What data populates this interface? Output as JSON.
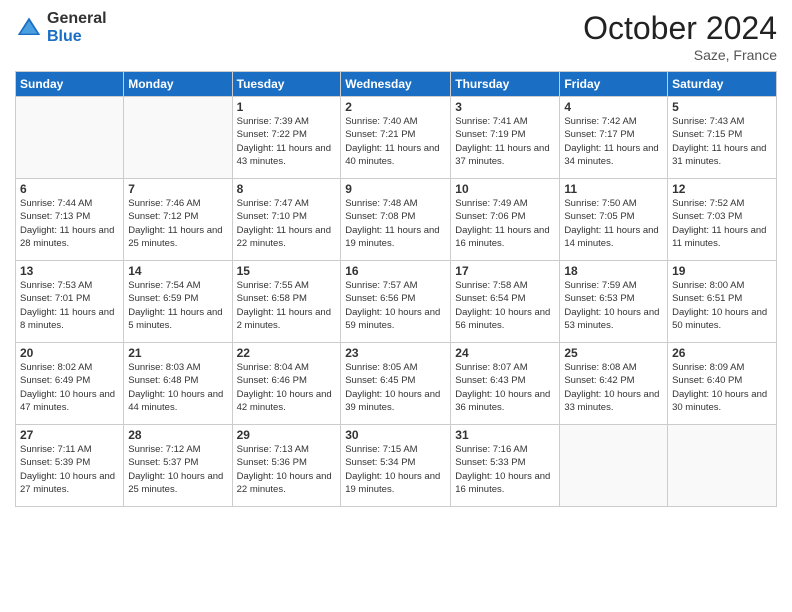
{
  "header": {
    "logo_general": "General",
    "logo_blue": "Blue",
    "month_year": "October 2024",
    "location": "Saze, France"
  },
  "days_of_week": [
    "Sunday",
    "Monday",
    "Tuesday",
    "Wednesday",
    "Thursday",
    "Friday",
    "Saturday"
  ],
  "weeks": [
    [
      {
        "day": "",
        "info": ""
      },
      {
        "day": "",
        "info": ""
      },
      {
        "day": "1",
        "info": "Sunrise: 7:39 AM\nSunset: 7:22 PM\nDaylight: 11 hours and 43 minutes."
      },
      {
        "day": "2",
        "info": "Sunrise: 7:40 AM\nSunset: 7:21 PM\nDaylight: 11 hours and 40 minutes."
      },
      {
        "day": "3",
        "info": "Sunrise: 7:41 AM\nSunset: 7:19 PM\nDaylight: 11 hours and 37 minutes."
      },
      {
        "day": "4",
        "info": "Sunrise: 7:42 AM\nSunset: 7:17 PM\nDaylight: 11 hours and 34 minutes."
      },
      {
        "day": "5",
        "info": "Sunrise: 7:43 AM\nSunset: 7:15 PM\nDaylight: 11 hours and 31 minutes."
      }
    ],
    [
      {
        "day": "6",
        "info": "Sunrise: 7:44 AM\nSunset: 7:13 PM\nDaylight: 11 hours and 28 minutes."
      },
      {
        "day": "7",
        "info": "Sunrise: 7:46 AM\nSunset: 7:12 PM\nDaylight: 11 hours and 25 minutes."
      },
      {
        "day": "8",
        "info": "Sunrise: 7:47 AM\nSunset: 7:10 PM\nDaylight: 11 hours and 22 minutes."
      },
      {
        "day": "9",
        "info": "Sunrise: 7:48 AM\nSunset: 7:08 PM\nDaylight: 11 hours and 19 minutes."
      },
      {
        "day": "10",
        "info": "Sunrise: 7:49 AM\nSunset: 7:06 PM\nDaylight: 11 hours and 16 minutes."
      },
      {
        "day": "11",
        "info": "Sunrise: 7:50 AM\nSunset: 7:05 PM\nDaylight: 11 hours and 14 minutes."
      },
      {
        "day": "12",
        "info": "Sunrise: 7:52 AM\nSunset: 7:03 PM\nDaylight: 11 hours and 11 minutes."
      }
    ],
    [
      {
        "day": "13",
        "info": "Sunrise: 7:53 AM\nSunset: 7:01 PM\nDaylight: 11 hours and 8 minutes."
      },
      {
        "day": "14",
        "info": "Sunrise: 7:54 AM\nSunset: 6:59 PM\nDaylight: 11 hours and 5 minutes."
      },
      {
        "day": "15",
        "info": "Sunrise: 7:55 AM\nSunset: 6:58 PM\nDaylight: 11 hours and 2 minutes."
      },
      {
        "day": "16",
        "info": "Sunrise: 7:57 AM\nSunset: 6:56 PM\nDaylight: 10 hours and 59 minutes."
      },
      {
        "day": "17",
        "info": "Sunrise: 7:58 AM\nSunset: 6:54 PM\nDaylight: 10 hours and 56 minutes."
      },
      {
        "day": "18",
        "info": "Sunrise: 7:59 AM\nSunset: 6:53 PM\nDaylight: 10 hours and 53 minutes."
      },
      {
        "day": "19",
        "info": "Sunrise: 8:00 AM\nSunset: 6:51 PM\nDaylight: 10 hours and 50 minutes."
      }
    ],
    [
      {
        "day": "20",
        "info": "Sunrise: 8:02 AM\nSunset: 6:49 PM\nDaylight: 10 hours and 47 minutes."
      },
      {
        "day": "21",
        "info": "Sunrise: 8:03 AM\nSunset: 6:48 PM\nDaylight: 10 hours and 44 minutes."
      },
      {
        "day": "22",
        "info": "Sunrise: 8:04 AM\nSunset: 6:46 PM\nDaylight: 10 hours and 42 minutes."
      },
      {
        "day": "23",
        "info": "Sunrise: 8:05 AM\nSunset: 6:45 PM\nDaylight: 10 hours and 39 minutes."
      },
      {
        "day": "24",
        "info": "Sunrise: 8:07 AM\nSunset: 6:43 PM\nDaylight: 10 hours and 36 minutes."
      },
      {
        "day": "25",
        "info": "Sunrise: 8:08 AM\nSunset: 6:42 PM\nDaylight: 10 hours and 33 minutes."
      },
      {
        "day": "26",
        "info": "Sunrise: 8:09 AM\nSunset: 6:40 PM\nDaylight: 10 hours and 30 minutes."
      }
    ],
    [
      {
        "day": "27",
        "info": "Sunrise: 7:11 AM\nSunset: 5:39 PM\nDaylight: 10 hours and 27 minutes."
      },
      {
        "day": "28",
        "info": "Sunrise: 7:12 AM\nSunset: 5:37 PM\nDaylight: 10 hours and 25 minutes."
      },
      {
        "day": "29",
        "info": "Sunrise: 7:13 AM\nSunset: 5:36 PM\nDaylight: 10 hours and 22 minutes."
      },
      {
        "day": "30",
        "info": "Sunrise: 7:15 AM\nSunset: 5:34 PM\nDaylight: 10 hours and 19 minutes."
      },
      {
        "day": "31",
        "info": "Sunrise: 7:16 AM\nSunset: 5:33 PM\nDaylight: 10 hours and 16 minutes."
      },
      {
        "day": "",
        "info": ""
      },
      {
        "day": "",
        "info": ""
      }
    ]
  ]
}
